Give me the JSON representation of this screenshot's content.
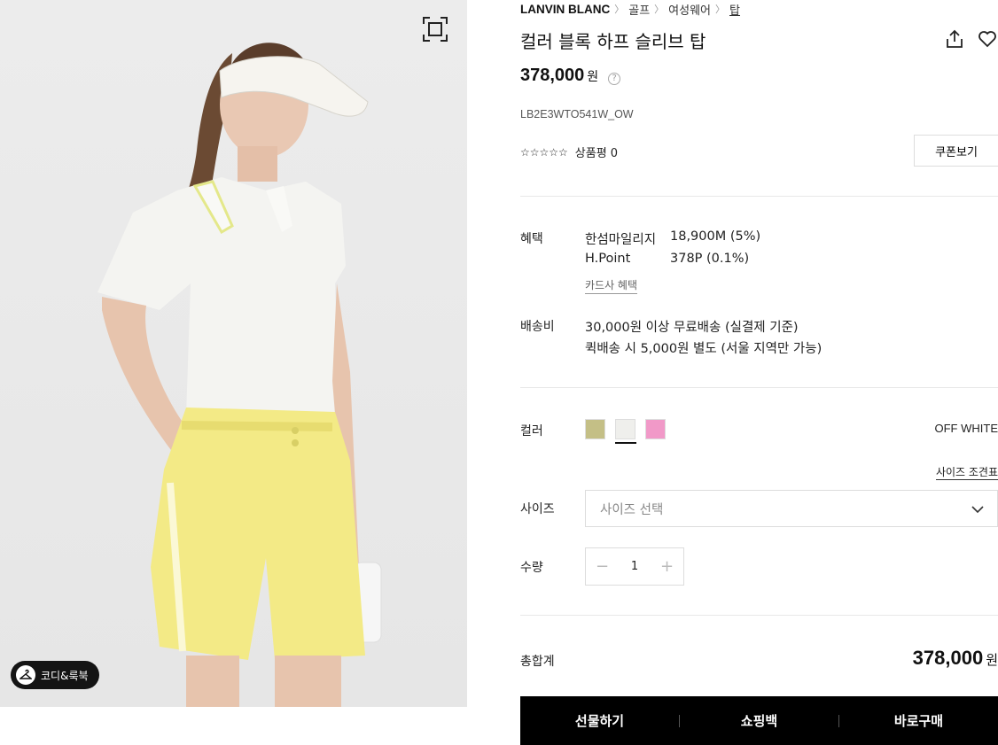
{
  "photo": {
    "coordi_label": "코디&룩북"
  },
  "breadcrumb": {
    "brand": "LANVIN BLANC",
    "items": [
      "골프",
      "여성웨어",
      "탑"
    ]
  },
  "product": {
    "title": "컬러 블록 하프 슬리브 탑",
    "price": "378,000",
    "price_unit": "원",
    "price_help": "?",
    "code": "LB2E3WTO541W_OW",
    "stars": "☆☆☆☆☆",
    "review_label": "상품평 0",
    "coupon_label": "쿠폰보기"
  },
  "benefits": {
    "label": "혜택",
    "rows": [
      {
        "name": "한섬마일리지",
        "value": "18,900M (5%)"
      },
      {
        "name": "H.Point",
        "value": "378P (0.1%)"
      }
    ],
    "card_link": "카드사 혜택"
  },
  "shipping": {
    "label": "배송비",
    "line1": "30,000원 이상 무료배송 (실결제 기준)",
    "line2": "퀵배송 시 5,000원 별도 (서울 지역만 가능)"
  },
  "color": {
    "label": "컬러",
    "selected_name": "OFF WHITE",
    "swatches": [
      "#c4bf86",
      "#efefec",
      "#f199c8"
    ]
  },
  "size": {
    "label": "사이즈",
    "guide_link": "사이즈 조견표",
    "placeholder": "사이즈 선택"
  },
  "quantity": {
    "label": "수량",
    "value": "1"
  },
  "total": {
    "label": "총합계",
    "price": "378,000",
    "unit": "원"
  },
  "actions": {
    "gift": "선물하기",
    "cart": "쇼핑백",
    "buy": "바로구매"
  }
}
